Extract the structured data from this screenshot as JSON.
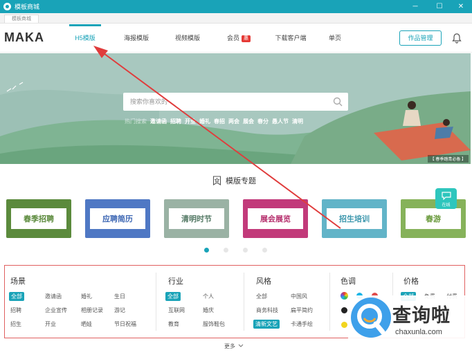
{
  "window": {
    "title": "模板商城",
    "tab": "模板商城",
    "min": "─",
    "max": "☐",
    "close": "✕"
  },
  "nav": {
    "brand": "MAKA",
    "items": [
      {
        "label": "H5模版",
        "active": true
      },
      {
        "label": "海报模版"
      },
      {
        "label": "视频模版"
      },
      {
        "label": "会员",
        "badge": "惠"
      },
      {
        "label": "下载客户端"
      },
      {
        "label": "单页"
      }
    ],
    "manage_button": "作品管理"
  },
  "banner": {
    "search_placeholder": "搜索你喜欢的",
    "hot_label": "热门搜索",
    "hot": [
      "邀请函",
      "招聘",
      "开业",
      "婚礼",
      "春招",
      "两会",
      "展会",
      "春分",
      "愚人节",
      "清明"
    ],
    "caption": "【 春季踏青必备 】"
  },
  "topics": {
    "title": "模版专题",
    "cards": [
      "春季招聘",
      "应聘简历",
      "清明时节",
      "展会展览",
      "招生培训",
      "春游"
    ]
  },
  "chat": {
    "label": "在线"
  },
  "filters": {
    "scene": {
      "title": "场景",
      "items": [
        "全部",
        "邀请函",
        "婚礼",
        "生日",
        "招聘",
        "企业宣传",
        "相册记录",
        "游记",
        "招生",
        "开业",
        "晒娃",
        "节日祝福"
      ]
    },
    "industry": {
      "title": "行业",
      "items": [
        "全部",
        "个人",
        "互联网",
        "婚庆",
        "教育",
        "服饰鞋包"
      ]
    },
    "style": {
      "title": "风格",
      "items": [
        "全部",
        "中国风",
        "商务科技",
        "扁平简约",
        "清新文艺",
        "卡通手绘"
      ]
    },
    "color": {
      "title": "色调",
      "colors": [
        "#19b5e6",
        "#e04a4a",
        "#222222",
        "#f2d51e"
      ]
    },
    "price": {
      "title": "价格",
      "items": [
        "全部",
        "免费",
        "付费"
      ]
    }
  },
  "more": "更多",
  "watermark": {
    "big": "查询啦",
    "small": "chaxunla.com"
  },
  "colors": {
    "accent": "#19a3b8",
    "badge": "#e53935",
    "annotation": "#e03c3c"
  }
}
